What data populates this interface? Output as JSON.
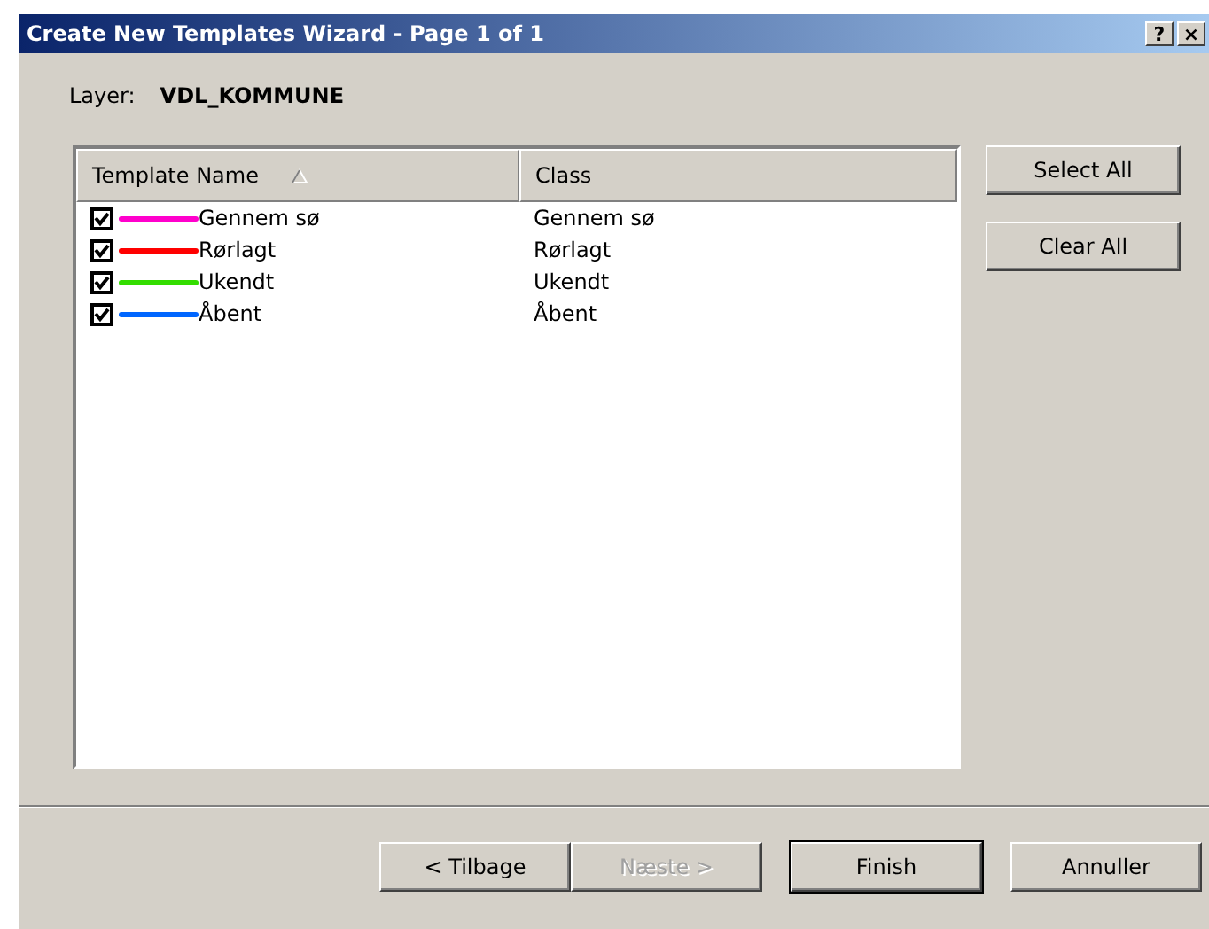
{
  "window": {
    "title": "Create New Templates Wizard - Page 1 of 1",
    "title_buttons": [
      "?",
      "×"
    ]
  },
  "layer": {
    "label": "Layer:",
    "value": "VDL_KOMMUNE"
  },
  "table": {
    "columns": [
      {
        "label": "Template Name",
        "sorted": true
      },
      {
        "label": "Class",
        "sorted": false
      }
    ],
    "rows": [
      {
        "checked": true,
        "color": "#ff00cc",
        "name": "Gennem sø",
        "class": "Gennem sø"
      },
      {
        "checked": true,
        "color": "#ff0000",
        "name": "Rørlagt",
        "class": "Rørlagt"
      },
      {
        "checked": true,
        "color": "#33dd00",
        "name": "Ukendt",
        "class": "Ukendt"
      },
      {
        "checked": true,
        "color": "#0066ff",
        "name": "Åbent",
        "class": "Åbent"
      }
    ]
  },
  "side_buttons": [
    "Select All",
    "Clear All"
  ],
  "footer_buttons": [
    {
      "label": "< Tilbage",
      "disabled": false,
      "default": false
    },
    {
      "label": "Næste >",
      "disabled": true,
      "default": false
    },
    {
      "label": "Finish",
      "disabled": false,
      "default": true
    },
    {
      "label": "Annuller",
      "disabled": false,
      "default": false
    }
  ]
}
